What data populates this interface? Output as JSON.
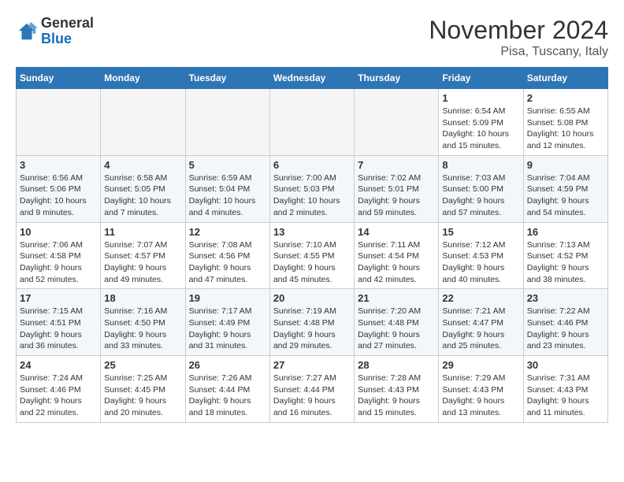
{
  "header": {
    "logo_general": "General",
    "logo_blue": "Blue",
    "month_title": "November 2024",
    "location": "Pisa, Tuscany, Italy"
  },
  "days_of_week": [
    "Sunday",
    "Monday",
    "Tuesday",
    "Wednesday",
    "Thursday",
    "Friday",
    "Saturday"
  ],
  "weeks": [
    [
      {
        "day": "",
        "info": ""
      },
      {
        "day": "",
        "info": ""
      },
      {
        "day": "",
        "info": ""
      },
      {
        "day": "",
        "info": ""
      },
      {
        "day": "",
        "info": ""
      },
      {
        "day": "1",
        "info": "Sunrise: 6:54 AM\nSunset: 5:09 PM\nDaylight: 10 hours and 15 minutes."
      },
      {
        "day": "2",
        "info": "Sunrise: 6:55 AM\nSunset: 5:08 PM\nDaylight: 10 hours and 12 minutes."
      }
    ],
    [
      {
        "day": "3",
        "info": "Sunrise: 6:56 AM\nSunset: 5:06 PM\nDaylight: 10 hours and 9 minutes."
      },
      {
        "day": "4",
        "info": "Sunrise: 6:58 AM\nSunset: 5:05 PM\nDaylight: 10 hours and 7 minutes."
      },
      {
        "day": "5",
        "info": "Sunrise: 6:59 AM\nSunset: 5:04 PM\nDaylight: 10 hours and 4 minutes."
      },
      {
        "day": "6",
        "info": "Sunrise: 7:00 AM\nSunset: 5:03 PM\nDaylight: 10 hours and 2 minutes."
      },
      {
        "day": "7",
        "info": "Sunrise: 7:02 AM\nSunset: 5:01 PM\nDaylight: 9 hours and 59 minutes."
      },
      {
        "day": "8",
        "info": "Sunrise: 7:03 AM\nSunset: 5:00 PM\nDaylight: 9 hours and 57 minutes."
      },
      {
        "day": "9",
        "info": "Sunrise: 7:04 AM\nSunset: 4:59 PM\nDaylight: 9 hours and 54 minutes."
      }
    ],
    [
      {
        "day": "10",
        "info": "Sunrise: 7:06 AM\nSunset: 4:58 PM\nDaylight: 9 hours and 52 minutes."
      },
      {
        "day": "11",
        "info": "Sunrise: 7:07 AM\nSunset: 4:57 PM\nDaylight: 9 hours and 49 minutes."
      },
      {
        "day": "12",
        "info": "Sunrise: 7:08 AM\nSunset: 4:56 PM\nDaylight: 9 hours and 47 minutes."
      },
      {
        "day": "13",
        "info": "Sunrise: 7:10 AM\nSunset: 4:55 PM\nDaylight: 9 hours and 45 minutes."
      },
      {
        "day": "14",
        "info": "Sunrise: 7:11 AM\nSunset: 4:54 PM\nDaylight: 9 hours and 42 minutes."
      },
      {
        "day": "15",
        "info": "Sunrise: 7:12 AM\nSunset: 4:53 PM\nDaylight: 9 hours and 40 minutes."
      },
      {
        "day": "16",
        "info": "Sunrise: 7:13 AM\nSunset: 4:52 PM\nDaylight: 9 hours and 38 minutes."
      }
    ],
    [
      {
        "day": "17",
        "info": "Sunrise: 7:15 AM\nSunset: 4:51 PM\nDaylight: 9 hours and 36 minutes."
      },
      {
        "day": "18",
        "info": "Sunrise: 7:16 AM\nSunset: 4:50 PM\nDaylight: 9 hours and 33 minutes."
      },
      {
        "day": "19",
        "info": "Sunrise: 7:17 AM\nSunset: 4:49 PM\nDaylight: 9 hours and 31 minutes."
      },
      {
        "day": "20",
        "info": "Sunrise: 7:19 AM\nSunset: 4:48 PM\nDaylight: 9 hours and 29 minutes."
      },
      {
        "day": "21",
        "info": "Sunrise: 7:20 AM\nSunset: 4:48 PM\nDaylight: 9 hours and 27 minutes."
      },
      {
        "day": "22",
        "info": "Sunrise: 7:21 AM\nSunset: 4:47 PM\nDaylight: 9 hours and 25 minutes."
      },
      {
        "day": "23",
        "info": "Sunrise: 7:22 AM\nSunset: 4:46 PM\nDaylight: 9 hours and 23 minutes."
      }
    ],
    [
      {
        "day": "24",
        "info": "Sunrise: 7:24 AM\nSunset: 4:46 PM\nDaylight: 9 hours and 22 minutes."
      },
      {
        "day": "25",
        "info": "Sunrise: 7:25 AM\nSunset: 4:45 PM\nDaylight: 9 hours and 20 minutes."
      },
      {
        "day": "26",
        "info": "Sunrise: 7:26 AM\nSunset: 4:44 PM\nDaylight: 9 hours and 18 minutes."
      },
      {
        "day": "27",
        "info": "Sunrise: 7:27 AM\nSunset: 4:44 PM\nDaylight: 9 hours and 16 minutes."
      },
      {
        "day": "28",
        "info": "Sunrise: 7:28 AM\nSunset: 4:43 PM\nDaylight: 9 hours and 15 minutes."
      },
      {
        "day": "29",
        "info": "Sunrise: 7:29 AM\nSunset: 4:43 PM\nDaylight: 9 hours and 13 minutes."
      },
      {
        "day": "30",
        "info": "Sunrise: 7:31 AM\nSunset: 4:43 PM\nDaylight: 9 hours and 11 minutes."
      }
    ]
  ]
}
